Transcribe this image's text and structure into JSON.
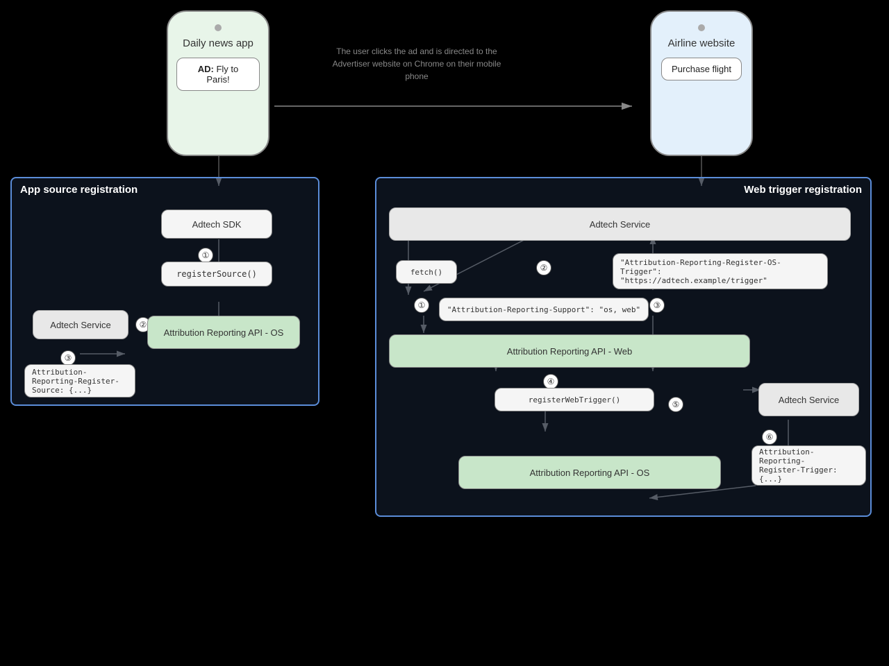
{
  "phones": {
    "left": {
      "title": "Daily news app",
      "ad_label": "AD:",
      "ad_text": "Fly to Paris!",
      "type": "green"
    },
    "right": {
      "title": "Airline website",
      "button_text": "Purchase flight",
      "type": "blue"
    }
  },
  "description": "The user clicks the ad and is directed to\nthe Advertiser website on Chrome on\ntheir mobile phone",
  "app_source": {
    "title": "App source registration",
    "adtech_sdk": "Adtech SDK",
    "adtech_service": "Adtech Service",
    "register_source": "registerSource()",
    "attribution_api_os": "Attribution Reporting API - OS",
    "code_box": "Attribution-Reporting-Register-\nSource: {...}",
    "steps": [
      "①",
      "②",
      "③"
    ]
  },
  "web_trigger": {
    "title": "Web trigger registration",
    "adtech_service_top": "Adtech Service",
    "fetch": "fetch()",
    "os_trigger_header": "\"Attribution-Reporting-Register-OS-Trigger\":\n\"https://adtech.example/trigger\"",
    "support_header": "\"Attribution-Reporting-Support\": \"os, web\"",
    "attribution_api_web": "Attribution Reporting API - Web",
    "register_web_trigger": "registerWebTrigger()",
    "attribution_api_os": "Attribution Reporting API - OS",
    "adtech_service_right": "Adtech Service",
    "trigger_header": "Attribution-Reporting-\nRegister-Trigger: {...}",
    "steps": [
      "①",
      "②",
      "③",
      "④",
      "⑤",
      "⑥"
    ]
  }
}
